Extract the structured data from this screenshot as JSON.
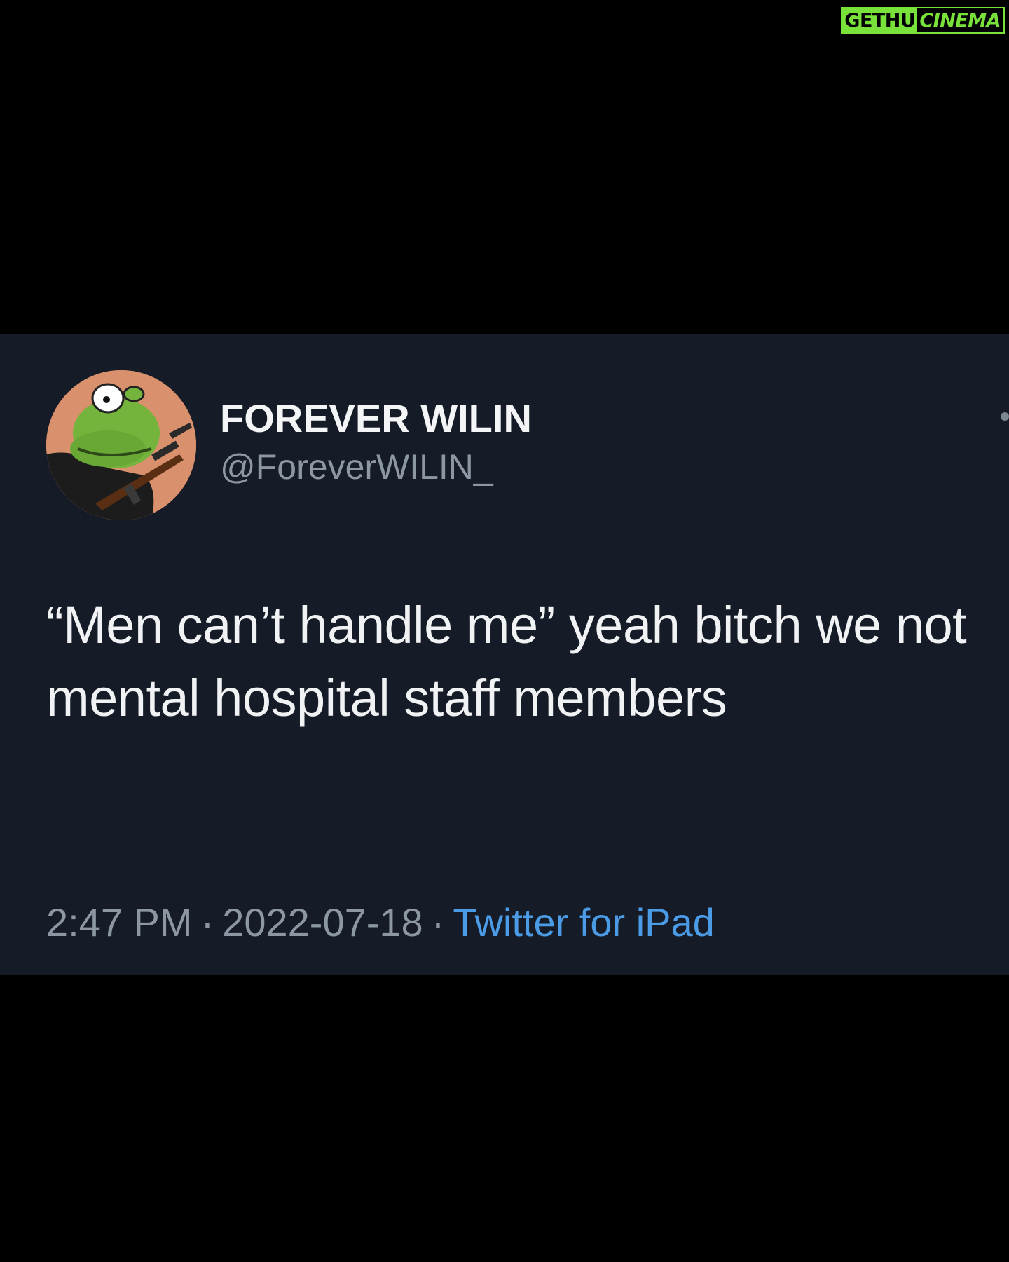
{
  "watermark": {
    "part1": "GETHU",
    "part2": "CINEMA"
  },
  "tweet": {
    "display_name": "FOREVER WILIN",
    "handle": "@ForeverWILIN_",
    "text": "“Men can’t handle me” yeah bitch we not mental hospital staff members",
    "time": "2:47 PM",
    "separator": "·",
    "date": "2022-07-18",
    "source": "Twitter for iPad",
    "avatar_icon": "kermit-frog-with-rifle-avatar",
    "more_icon": "more-dot-icon"
  },
  "colors": {
    "background": "#000000",
    "card": "#151c27",
    "primary_text": "#f1f2f4",
    "secondary_text": "#8c97a3",
    "link": "#4b9be6",
    "watermark": "#78e23a"
  }
}
